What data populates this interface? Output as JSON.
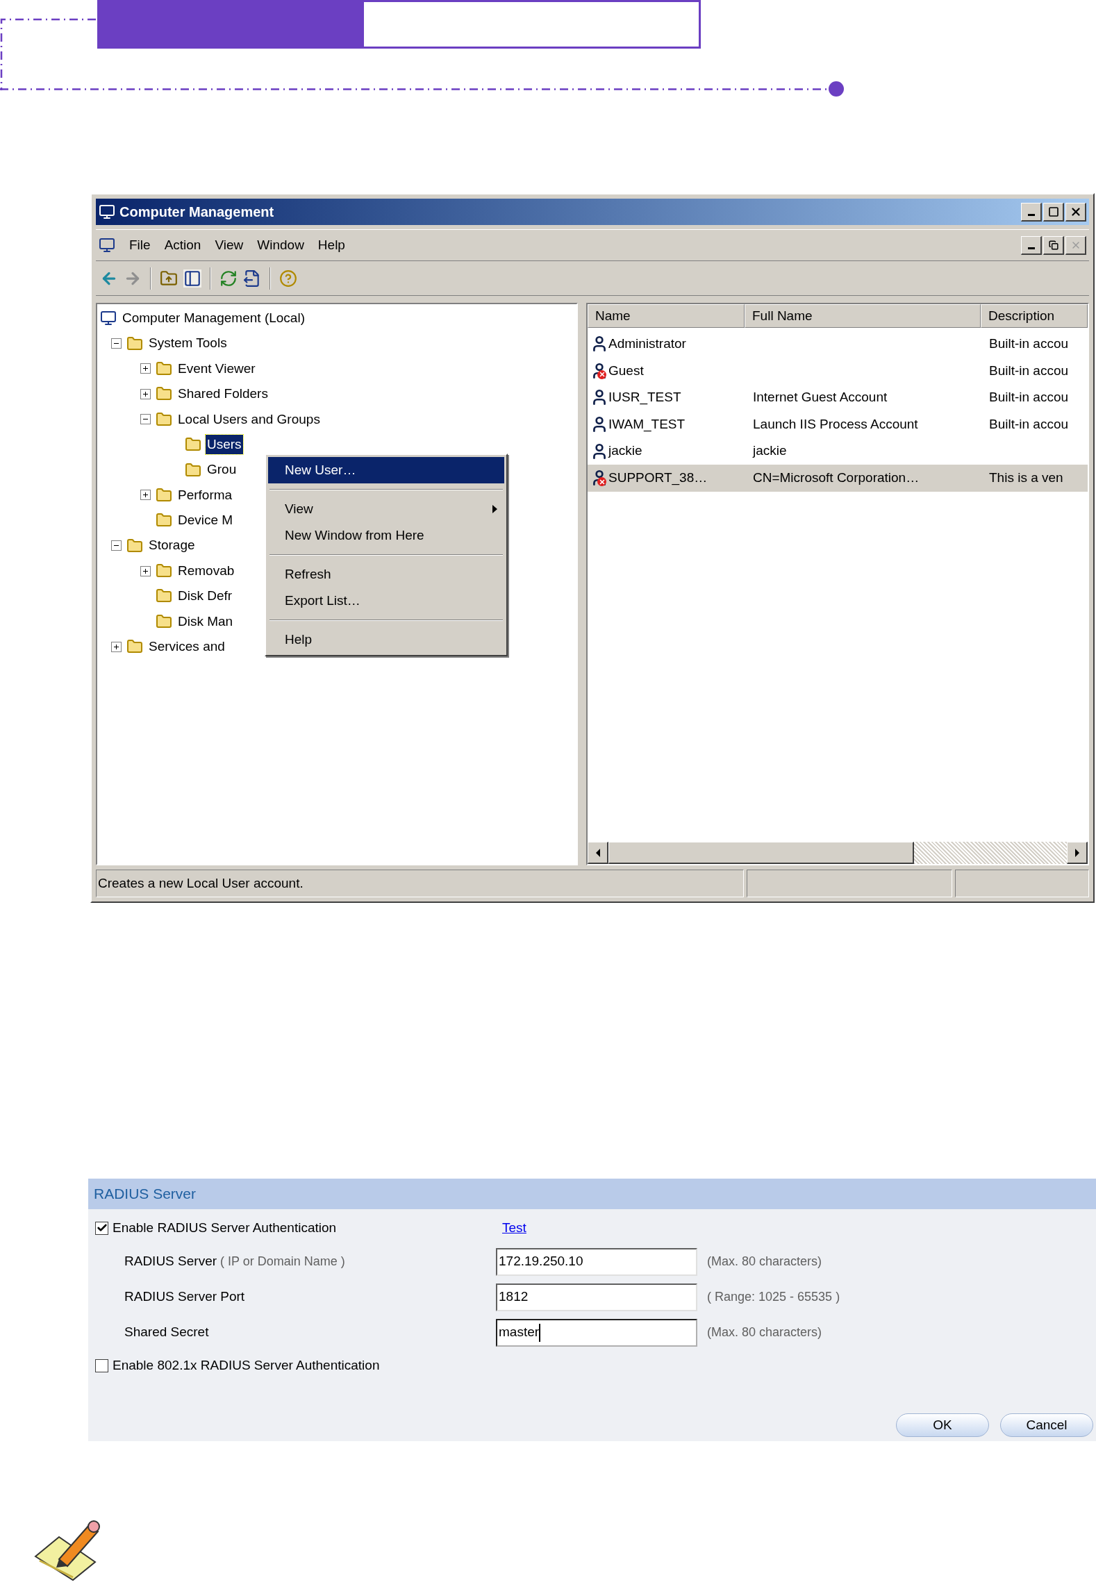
{
  "window": {
    "title": "Computer Management",
    "menu": [
      {
        "label": "File"
      },
      {
        "label": "Action"
      },
      {
        "label": "View"
      },
      {
        "label": "Window"
      },
      {
        "label": "Help"
      }
    ],
    "tree": [
      {
        "label": "Computer Management (Local)",
        "selected": false,
        "children": [
          {
            "label": "System Tools",
            "expanded": true,
            "selected": false,
            "children": [
              {
                "label": "Event Viewer",
                "expanded": false,
                "selected": false
              },
              {
                "label": "Shared Folders",
                "expanded": false,
                "selected": false
              },
              {
                "label": "Local Users and Groups",
                "expanded": true,
                "selected": false,
                "children": [
                  {
                    "label": "Users",
                    "selected": true
                  },
                  {
                    "label": "Grou",
                    "selected": false
                  }
                ]
              },
              {
                "label": "Performa",
                "expanded": false,
                "selected": false
              },
              {
                "label": "Device M",
                "selected": false
              }
            ]
          },
          {
            "label": "Storage",
            "expanded": true,
            "selected": false,
            "children": [
              {
                "label": "Removab",
                "expanded": false,
                "selected": false
              },
              {
                "label": "Disk Defr",
                "selected": false
              },
              {
                "label": "Disk Man",
                "selected": false
              }
            ]
          },
          {
            "label": "Services and",
            "expanded": false,
            "selected": false
          }
        ]
      }
    ],
    "context_menu": [
      {
        "kind": "item",
        "label": "New User…",
        "selected": true
      },
      {
        "kind": "separator"
      },
      {
        "kind": "submenu",
        "label": "View",
        "selected": false
      },
      {
        "kind": "item",
        "label": "New Window from Here",
        "selected": false
      },
      {
        "kind": "separator"
      },
      {
        "kind": "item",
        "label": "Refresh",
        "selected": false
      },
      {
        "kind": "item",
        "label": "Export List…",
        "selected": false
      },
      {
        "kind": "separator"
      },
      {
        "kind": "item",
        "label": "Help",
        "selected": false
      }
    ],
    "list": {
      "columns": [
        "Name",
        "Full Name",
        "Description"
      ],
      "rows": [
        {
          "name": "Administrator",
          "full_name": "",
          "description": "Built-in accou",
          "disabled": false,
          "selected": false
        },
        {
          "name": "Guest",
          "full_name": "",
          "description": "Built-in accou",
          "disabled": true,
          "selected": false
        },
        {
          "name": "IUSR_TEST",
          "full_name": "Internet Guest Account",
          "description": "Built-in accou",
          "disabled": false,
          "selected": false
        },
        {
          "name": "IWAM_TEST",
          "full_name": "Launch IIS Process Account",
          "description": "Built-in accou",
          "disabled": false,
          "selected": false
        },
        {
          "name": "jackie",
          "full_name": "jackie",
          "description": "",
          "disabled": false,
          "selected": false
        },
        {
          "name": "SUPPORT_38…",
          "full_name": "CN=Microsoft Corporation…",
          "description": "This is a ven",
          "disabled": true,
          "selected": true
        }
      ]
    },
    "status_bar": "Creates a new Local User account."
  },
  "radius": {
    "title": "RADIUS Server",
    "enable": {
      "label": "Enable RADIUS Server Authentication",
      "checked": true
    },
    "link": "Test",
    "fields": [
      {
        "label": "RADIUS Server",
        "label_note": "( IP or Domain Name )",
        "value": "172.19.250.10",
        "note": "(Max. 80 characters)",
        "focused": false
      },
      {
        "label": "RADIUS Server Port",
        "value": "1812",
        "note": "( Range: 1025 - 65535 )",
        "focused": false
      },
      {
        "label": "Shared Secret",
        "value": "master",
        "note": "(Max. 80 characters)",
        "focused": true
      }
    ],
    "enable_8021x": {
      "label": "Enable 802.1x RADIUS Server Authentication",
      "checked": false
    },
    "buttons": [
      "OK",
      "Cancel"
    ]
  }
}
